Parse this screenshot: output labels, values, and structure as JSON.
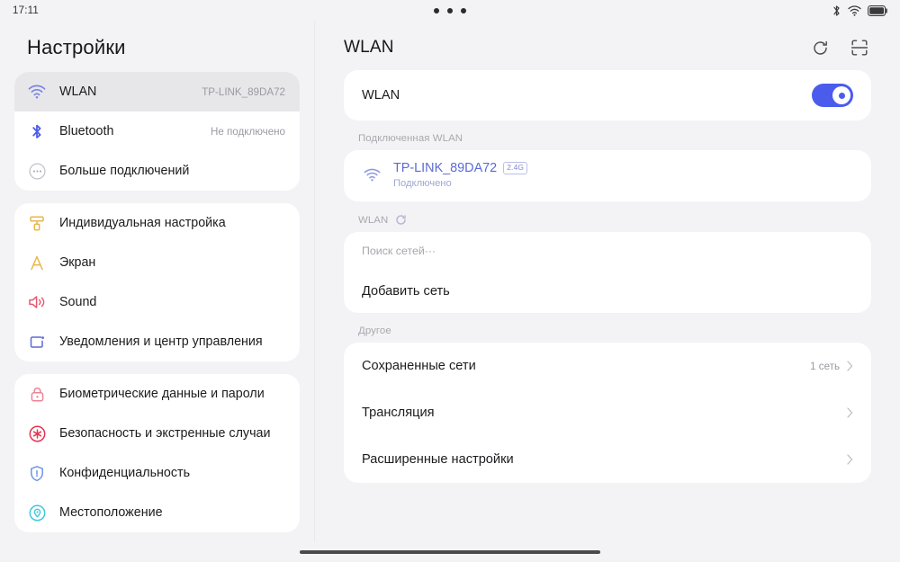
{
  "statusbar": {
    "clock": "17:11",
    "icons": [
      "bluetooth-icon",
      "wifi-icon",
      "battery-icon"
    ],
    "center_dots": "•••"
  },
  "sidebar": {
    "title": "Настройки",
    "groups": [
      {
        "items": [
          {
            "label": "WLAN",
            "value": "TP-LINK_89DA72",
            "icon": "wifi-icon",
            "icon_color": "#7b86e0",
            "selected": true
          },
          {
            "label": "Bluetooth",
            "value": "Не подключено",
            "icon": "bluetooth-icon",
            "icon_color": "#4b5ced",
            "selected": false
          },
          {
            "label": "Больше подключений",
            "value": "",
            "icon": "more-connections-icon",
            "icon_color": "#b9b9c1",
            "selected": false
          }
        ]
      },
      {
        "items": [
          {
            "label": "Индивидуальная настройка",
            "value": "",
            "icon": "paint-roller-icon",
            "icon_color": "#e8b64c",
            "selected": false
          },
          {
            "label": "Экран",
            "value": "",
            "icon": "display-letter-a-icon",
            "icon_color": "#e8b64c",
            "selected": false
          },
          {
            "label": "Sound",
            "value": "",
            "icon": "speaker-icon",
            "icon_color": "#e8566f",
            "selected": false
          },
          {
            "label": "Уведомления и центр управления",
            "value": "",
            "icon": "notification-square-icon",
            "icon_color": "#5a6ad6",
            "selected": false
          }
        ]
      },
      {
        "items": [
          {
            "label": "Биометрические данные и пароли",
            "value": "",
            "icon": "lock-icon",
            "icon_color": "#ef8296",
            "selected": false
          },
          {
            "label": "Безопасность и экстренные случаи",
            "value": "",
            "icon": "emergency-asterisk-icon",
            "icon_color": "#e8334f",
            "selected": false
          },
          {
            "label": "Конфиденциальность",
            "value": "",
            "icon": "shield-icon",
            "icon_color": "#6f94e8",
            "selected": false
          },
          {
            "label": "Местоположение",
            "value": "",
            "icon": "location-pin-icon",
            "icon_color": "#3fc8d8",
            "selected": false
          }
        ]
      }
    ]
  },
  "main": {
    "title": "WLAN",
    "actions": [
      {
        "name": "refresh-icon",
        "label": "Обновить"
      },
      {
        "name": "scan-qr-icon",
        "label": "Сканировать QR-код"
      }
    ],
    "wlan_toggle": {
      "label": "WLAN",
      "state": "on",
      "accent": "#4b5ced"
    },
    "connected_section": {
      "header": "Подключенная WLAN",
      "network": {
        "ssid": "TP-LINK_89DA72",
        "band_badge": "2.4G",
        "status": "Подключено",
        "icon": "wifi-icon",
        "color": "#5a6ad6"
      }
    },
    "scan_section": {
      "header": "WLAN",
      "header_icon": "loading-spinner-icon",
      "searching_text": "Поиск сетей···",
      "add_network_label": "Добавить сеть"
    },
    "other_section": {
      "header": "Другое",
      "rows": [
        {
          "label": "Сохраненные сети",
          "value": "1 сеть",
          "chevron": true
        },
        {
          "label": "Трансляция",
          "value": "",
          "chevron": true
        },
        {
          "label": "Расширенные настройки",
          "value": "",
          "chevron": true
        }
      ]
    }
  },
  "home_indicator": {
    "name": "home-indicator"
  }
}
